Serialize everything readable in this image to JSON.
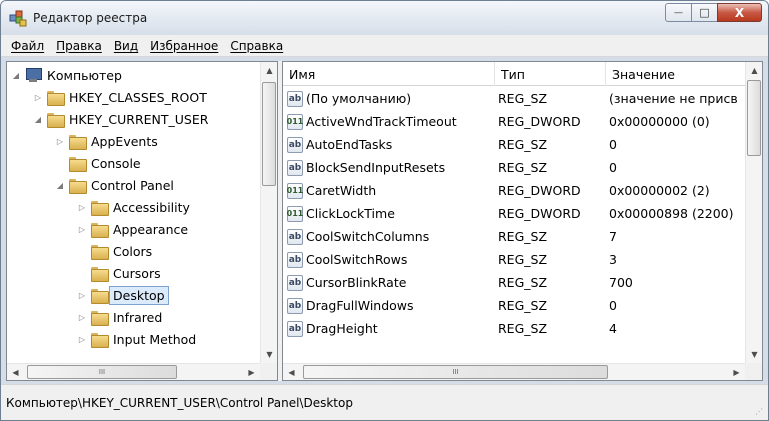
{
  "window": {
    "title": "Редактор реестра",
    "minimize_glyph": "—",
    "maximize_glyph": "□",
    "close_glyph": "X"
  },
  "menu": [
    "Файл",
    "Правка",
    "Вид",
    "Избранное",
    "Справка"
  ],
  "tree": {
    "items": [
      {
        "label": "Компьютер",
        "expander": "◢",
        "kind": "computer"
      },
      {
        "label": "HKEY_CLASSES_ROOT",
        "expander": "▷",
        "kind": "folder"
      },
      {
        "label": "HKEY_CURRENT_USER",
        "expander": "◢",
        "kind": "folder"
      },
      {
        "label": "AppEvents",
        "expander": "▷",
        "kind": "folder"
      },
      {
        "label": "Console",
        "expander": "",
        "kind": "folder"
      },
      {
        "label": "Control Panel",
        "expander": "◢",
        "kind": "folder"
      },
      {
        "label": "Accessibility",
        "expander": "▷",
        "kind": "folder"
      },
      {
        "label": "Appearance",
        "expander": "▷",
        "kind": "folder"
      },
      {
        "label": "Colors",
        "expander": "",
        "kind": "folder"
      },
      {
        "label": "Cursors",
        "expander": "",
        "kind": "folder"
      },
      {
        "label": "Desktop",
        "expander": "▷",
        "kind": "folder",
        "selected": true
      },
      {
        "label": "Infrared",
        "expander": "▷",
        "kind": "folder"
      },
      {
        "label": "Input Method",
        "expander": "▷",
        "kind": "folder"
      }
    ],
    "hscroll_glyph": "III"
  },
  "list": {
    "columns": [
      "Имя",
      "Тип",
      "Значение"
    ],
    "rows": [
      {
        "icon": "ab",
        "name": "(По умолчанию)",
        "type": "REG_SZ",
        "data": "(значение не присв"
      },
      {
        "icon": "bin",
        "name": "ActiveWndTrackTimeout",
        "type": "REG_DWORD",
        "data": "0x00000000 (0)"
      },
      {
        "icon": "ab",
        "name": "AutoEndTasks",
        "type": "REG_SZ",
        "data": "0"
      },
      {
        "icon": "ab",
        "name": "BlockSendInputResets",
        "type": "REG_SZ",
        "data": "0"
      },
      {
        "icon": "bin",
        "name": "CaretWidth",
        "type": "REG_DWORD",
        "data": "0x00000002 (2)"
      },
      {
        "icon": "bin",
        "name": "ClickLockTime",
        "type": "REG_DWORD",
        "data": "0x00000898 (2200)"
      },
      {
        "icon": "ab",
        "name": "CoolSwitchColumns",
        "type": "REG_SZ",
        "data": "7"
      },
      {
        "icon": "ab",
        "name": "CoolSwitchRows",
        "type": "REG_SZ",
        "data": "3"
      },
      {
        "icon": "ab",
        "name": "CursorBlinkRate",
        "type": "REG_SZ",
        "data": "700"
      },
      {
        "icon": "ab",
        "name": "DragFullWindows",
        "type": "REG_SZ",
        "data": "0"
      },
      {
        "icon": "ab",
        "name": "DragHeight",
        "type": "REG_SZ",
        "data": "4"
      }
    ],
    "hscroll_glyph": "III"
  },
  "icons": {
    "ab": "ab",
    "bin": "011"
  },
  "status": {
    "path": "Компьютер\\HKEY_CURRENT_USER\\Control Panel\\Desktop"
  }
}
